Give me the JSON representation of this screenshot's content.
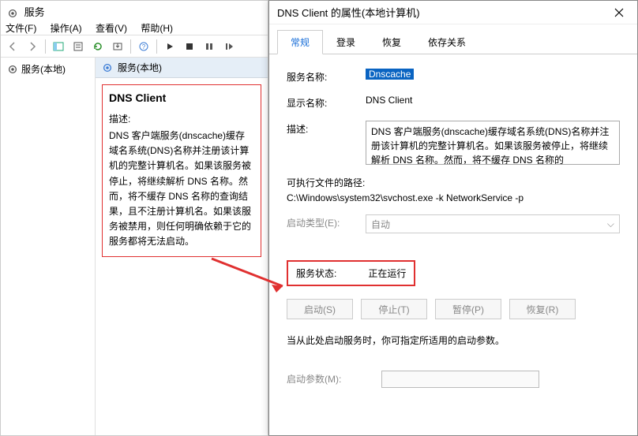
{
  "main": {
    "title": "服务",
    "menu": {
      "file": "文件(F)",
      "action": "操作(A)",
      "view": "查看(V)",
      "help": "帮助(H)"
    },
    "tree_root": "服务(本地)",
    "pane_header": "服务(本地)",
    "detail": {
      "name": "DNS Client",
      "desc_label": "描述:",
      "desc": "DNS 客户端服务(dnscache)缓存域名系统(DNS)名称并注册该计算机的完整计算机名。如果该服务被停止，将继续解析 DNS 名称。然而，将不缓存 DNS 名称的查询结果，且不注册计算机名。如果该服务被禁用，则任何明确依赖于它的服务都将无法启动。"
    }
  },
  "dialog": {
    "title": "DNS Client 的属性(本地计算机)",
    "tabs": [
      "常规",
      "登录",
      "恢复",
      "依存关系"
    ],
    "active_tab": 0,
    "rows": {
      "service_name_label": "服务名称:",
      "service_name_value": "Dnscache",
      "display_name_label": "显示名称:",
      "display_name_value": "DNS Client",
      "desc_label": "描述:",
      "desc_value": "DNS 客户端服务(dnscache)缓存域名系统(DNS)名称并注册该计算机的完整计算机名。如果该服务被停止，将继续解析 DNS 名称。然而，将不缓存 DNS 名称的",
      "exe_label": "可执行文件的路径:",
      "exe_value": "C:\\Windows\\system32\\svchost.exe -k NetworkService -p",
      "startup_label": "启动类型(E):",
      "startup_value": "自动",
      "status_label": "服务状态:",
      "status_value": "正在运行",
      "start_btn": "启动(S)",
      "stop_btn": "停止(T)",
      "pause_btn": "暂停(P)",
      "resume_btn": "恢复(R)",
      "hint": "当从此处启动服务时，你可指定所适用的启动参数。",
      "param_label": "启动参数(M):"
    }
  }
}
